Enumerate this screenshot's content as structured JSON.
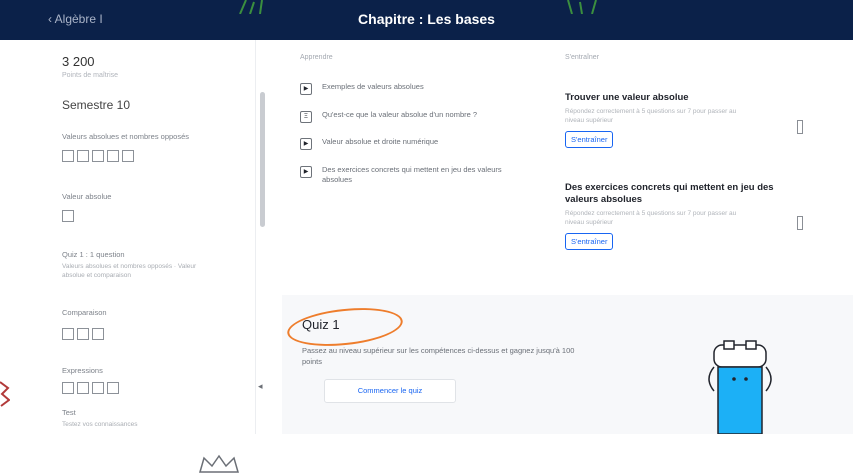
{
  "header": {
    "breadcrumb": "‹ Algèbre I",
    "title": "Chapitre : Les bases"
  },
  "sidebar": {
    "points": "3 200",
    "points_sub": "Points de maîtrise",
    "unit_title": "Semestre 10",
    "sections": [
      {
        "label": "Valeurs absolues et nombres opposés",
        "squares": 5
      },
      {
        "label": "Valeur absolue",
        "squares": 1
      },
      {
        "label": "Quiz 1 : 1 question",
        "sub": "Valeurs absolues et nombres opposés · Valeur absolue et comparaison",
        "squares": 0
      },
      {
        "label": "Comparaison",
        "squares": 3
      },
      {
        "label": "Expressions",
        "squares": 4
      },
      {
        "label": "Test",
        "sub": "Testez vos connaissances",
        "squares": 0
      }
    ],
    "scroll_arrow": "◂"
  },
  "main": {
    "left_heading": "Apprendre",
    "right_heading": "S'entraîner",
    "items": [
      {
        "icon": "▶",
        "text": "Exemples de valeurs absolues"
      },
      {
        "icon": "Ξ",
        "text": "Qu'est-ce que la valeur absolue d'un nombre ?"
      },
      {
        "icon": "▶",
        "text": "Valeur absolue et droite numérique"
      },
      {
        "icon": "▶",
        "text": "Des exercices concrets qui mettent en jeu des valeurs absolues"
      }
    ],
    "cards": [
      {
        "title": "Trouver une valeur absolue",
        "desc": "Répondez correctement à 5 questions sur 7 pour passer au niveau supérieur",
        "button": "S'entraîner"
      },
      {
        "title": "Des exercices concrets qui mettent en jeu des valeurs absolues",
        "desc": "Répondez correctement à 5 questions sur 7 pour passer au niveau supérieur",
        "button": "S'entraîner"
      }
    ]
  },
  "quiz": {
    "title": "Quiz 1",
    "desc": "Passez au niveau supérieur sur les compétences ci-dessus et gagnez jusqu'à 100 points",
    "button": "Commencer le quiz",
    "annotation_color": "#ee7d2c"
  },
  "colors": {
    "header_bg": "#0b2149",
    "accent": "#1865f2"
  }
}
